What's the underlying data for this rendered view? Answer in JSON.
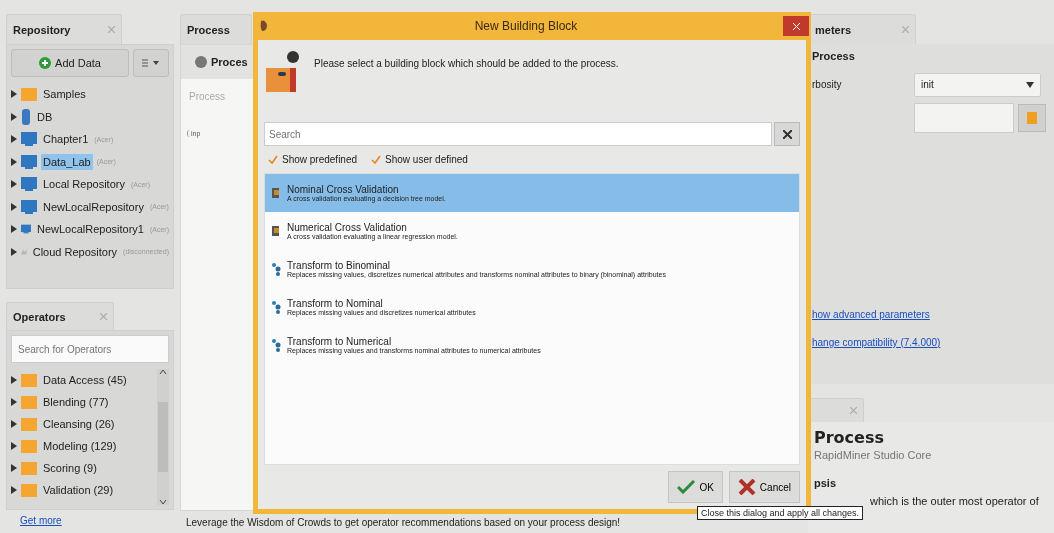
{
  "repository": {
    "tab": "Repository",
    "add_button": "Add Data",
    "items": [
      {
        "label": "Samples",
        "kind": "folder",
        "selected": false
      },
      {
        "label": "DB",
        "kind": "db",
        "selected": false
      },
      {
        "label": "Chapter1",
        "note": "(Acer)",
        "kind": "repo",
        "selected": false
      },
      {
        "label": "Data_Lab",
        "note": "(Acer)",
        "kind": "repo",
        "selected": true
      },
      {
        "label": "Local Repository",
        "note": "(Acer)",
        "kind": "repo",
        "selected": false
      },
      {
        "label": "NewLocalRepository",
        "note": "(Acer)",
        "kind": "repo",
        "selected": false
      },
      {
        "label": "NewLocalRepository1",
        "note": "(Acer)",
        "kind": "repo",
        "selected": false
      },
      {
        "label": "Cloud Repository",
        "note": "(disconnected)",
        "kind": "cloud",
        "selected": false
      }
    ]
  },
  "operators": {
    "tab": "Operators",
    "search_placeholder": "Search for Operators",
    "items": [
      {
        "label": "Data Access (45)"
      },
      {
        "label": "Blending (77)"
      },
      {
        "label": "Cleansing (26)"
      },
      {
        "label": "Modeling (129)"
      },
      {
        "label": "Scoring (9)"
      },
      {
        "label": "Validation (29)"
      }
    ],
    "link": "Get more"
  },
  "process": {
    "tab": "Process",
    "toolbar_button": "Proces",
    "breadcrumb": "Process",
    "port": "inp",
    "status": "Leverage the Wisdom of Crowds to get operator recommendations based on your process design!"
  },
  "parameters": {
    "tab": "meters",
    "heading": "Process",
    "rows": [
      {
        "label": "rbosity",
        "kind": "select",
        "value": "init"
      },
      {
        "kind": "file"
      }
    ],
    "links": [
      "how advanced parameters",
      "hange compatibility (7.4.000)"
    ]
  },
  "help": {
    "title": "Process",
    "subtitle": "RapidMiner Studio Core",
    "section": "psis",
    "text": "which is the outer most operator of"
  },
  "dialog": {
    "title": "New Building Block",
    "prompt": "Please select a building block which should be added to the process.",
    "search_placeholder": "Search",
    "filters": [
      {
        "label": "Show predefined",
        "checked": true
      },
      {
        "label": "Show user defined",
        "checked": true
      }
    ],
    "items": [
      {
        "title": "Nominal Cross Validation",
        "description": "A cross validation evaluating a decision tree model.",
        "kind": "validation",
        "selected": true
      },
      {
        "title": "Numerical Cross Validation",
        "description": "A cross validation evaluating a linear regression model.",
        "kind": "validation",
        "selected": false
      },
      {
        "title": "Transform to Binominal",
        "description": "Replaces missing values, discretizes numerical attributes and transforms nominal attributes to binary (binominal) attributes",
        "kind": "transform",
        "selected": false
      },
      {
        "title": "Transform to Nominal",
        "description": "Replaces missing values and discretizes numerical attributes",
        "kind": "transform",
        "selected": false
      },
      {
        "title": "Transform to Numerical",
        "description": "Replaces missing values and transforms nominal attributes to numerical attributes",
        "kind": "transform",
        "selected": false
      }
    ],
    "buttons": [
      {
        "label": "OK",
        "kind": "ok"
      },
      {
        "label": "Cancel",
        "kind": "cancel"
      }
    ]
  },
  "tooltip": "Close this dialog and apply all changes."
}
